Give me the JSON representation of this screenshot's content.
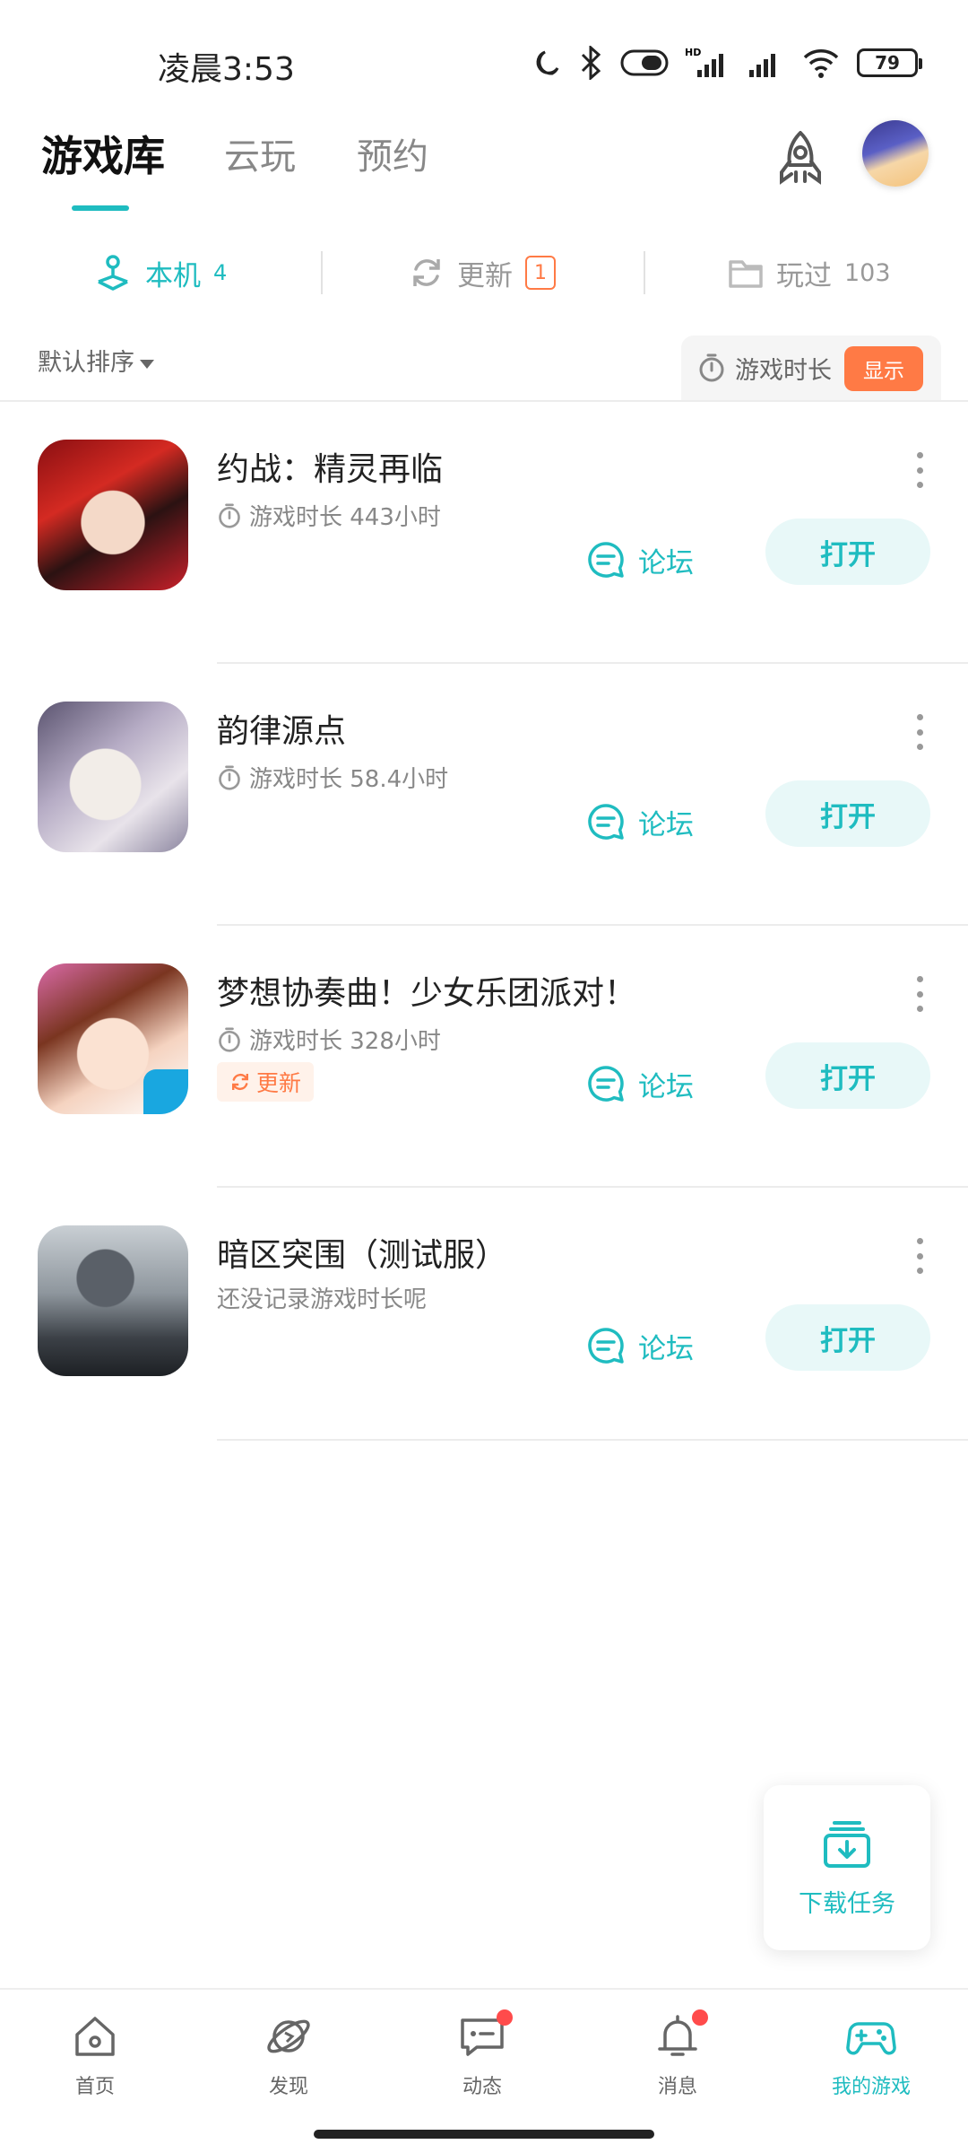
{
  "status_bar": {
    "time": "凌晨3:53",
    "battery": "79",
    "icons": [
      "moon-icon",
      "bluetooth-icon",
      "vibrate-icon",
      "signal-hd-icon",
      "signal-icon",
      "wifi-icon",
      "battery-icon"
    ]
  },
  "top_tabs": [
    {
      "label": "游戏库",
      "active": true
    },
    {
      "label": "云玩",
      "active": false
    },
    {
      "label": "预约",
      "active": false
    }
  ],
  "sub_tabs": {
    "local": {
      "label": "本机",
      "count": "4"
    },
    "update": {
      "label": "更新",
      "count": "1"
    },
    "played": {
      "label": "玩过",
      "count": "103"
    }
  },
  "sort": {
    "label": "默认排序"
  },
  "duration_toggle": {
    "label": "游戏时长",
    "button": "显示"
  },
  "games": [
    {
      "title": "约战：精灵再临",
      "duration": "游戏时长 443小时",
      "has_update": false,
      "forum": "论坛",
      "open": "打开"
    },
    {
      "title": "韵律源点",
      "duration": "游戏时长 58.4小时",
      "has_update": false,
      "forum": "论坛",
      "open": "打开"
    },
    {
      "title": "梦想协奏曲！少女乐团派对！",
      "duration": "游戏时长 328小时",
      "has_update": true,
      "update_label": "更新",
      "forum": "论坛",
      "open": "打开"
    },
    {
      "title": "暗区突围（测试服）",
      "duration": "还没记录游戏时长呢",
      "has_update": false,
      "forum": "论坛",
      "open": "打开"
    }
  ],
  "download_task": {
    "label": "下载任务"
  },
  "bottom_nav": [
    {
      "label": "首页",
      "icon": "home-icon",
      "active": false,
      "badge": false
    },
    {
      "label": "发现",
      "icon": "planet-icon",
      "active": false,
      "badge": false
    },
    {
      "label": "动态",
      "icon": "chat-icon",
      "active": false,
      "badge": true
    },
    {
      "label": "消息",
      "icon": "bell-icon",
      "active": false,
      "badge": true
    },
    {
      "label": "我的游戏",
      "icon": "gamepad-icon",
      "active": true,
      "badge": false
    }
  ],
  "colors": {
    "accent": "#1fbcc0",
    "orange": "#ff7a45",
    "badge_red": "#ff4b4b"
  }
}
